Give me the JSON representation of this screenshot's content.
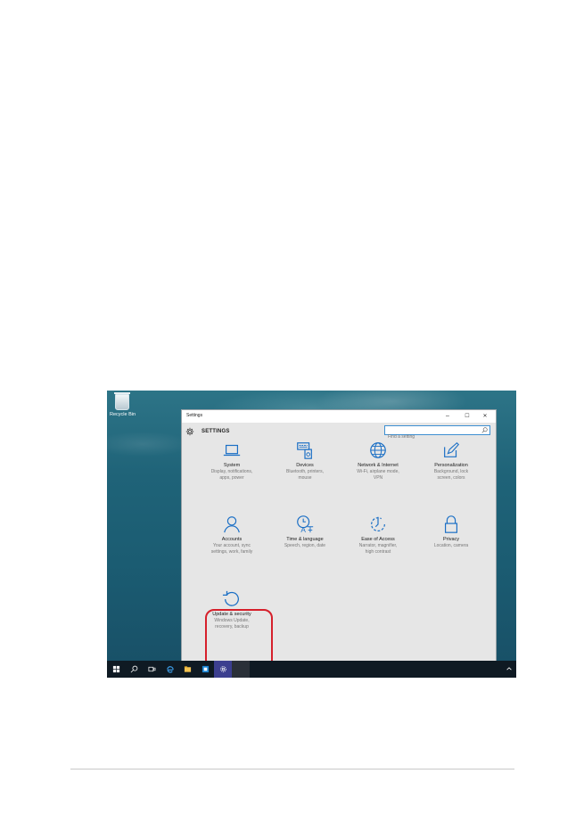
{
  "desktop": {
    "recycle_bin_label": "Recycle Bin"
  },
  "window": {
    "title": "Settings",
    "controls": {
      "minimize": "–",
      "maximize": "☐",
      "close": "✕"
    },
    "heading": "SETTINGS",
    "search": {
      "placeholder": "Find a setting"
    }
  },
  "tiles": [
    {
      "title": "System",
      "desc1": "Display, notifications,",
      "desc2": "apps, power",
      "icon": "laptop-icon"
    },
    {
      "title": "Devices",
      "desc1": "Bluetooth, printers,",
      "desc2": "mouse",
      "icon": "devices-icon"
    },
    {
      "title": "Network & Internet",
      "desc1": "Wi-Fi, airplane mode,",
      "desc2": "VPN",
      "icon": "globe-icon"
    },
    {
      "title": "Personalization",
      "desc1": "Background, lock",
      "desc2": "screen, colors",
      "icon": "paint-icon"
    },
    {
      "title": "Accounts",
      "desc1": "Your account, sync",
      "desc2": "settings, work, family",
      "icon": "person-icon"
    },
    {
      "title": "Time & language",
      "desc1": "Speech, region, date",
      "desc2": "",
      "icon": "clock-language-icon"
    },
    {
      "title": "Ease of Access",
      "desc1": "Narrator, magnifier,",
      "desc2": "high contrast",
      "icon": "ease-of-access-icon"
    },
    {
      "title": "Privacy",
      "desc1": "Location, camera",
      "desc2": "",
      "icon": "lock-icon"
    },
    {
      "title": "Update & security",
      "desc1": "Windows Update,",
      "desc2": "recovery, backup",
      "icon": "refresh-icon"
    }
  ],
  "taskbar": {
    "items": [
      "start-icon",
      "search-icon",
      "task-view-icon",
      "edge-icon",
      "file-explorer-icon",
      "store-icon",
      "settings-icon"
    ]
  },
  "colors": {
    "accent": "#1b6fc5",
    "highlight": "#d6202b",
    "taskbar": "#0f1a23"
  }
}
